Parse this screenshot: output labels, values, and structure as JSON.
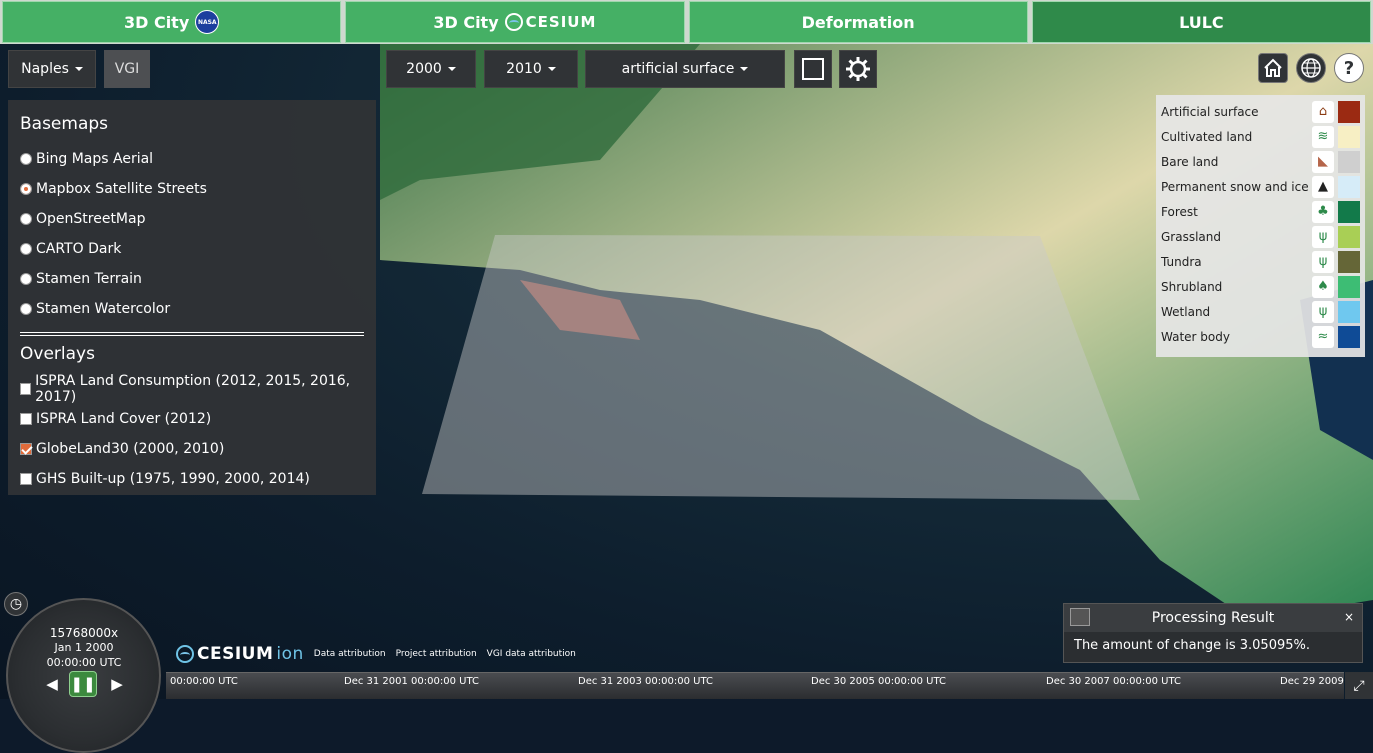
{
  "tabs": [
    {
      "label": "3D City",
      "logo": "nasa-logo",
      "logo_text": "NASA"
    },
    {
      "label": "3D City",
      "logo": "cesium-logo",
      "logo_text": "CESIUM"
    },
    {
      "label": "Deformation"
    },
    {
      "label": "LULC",
      "active": true
    }
  ],
  "toolbar": {
    "city": "Naples",
    "vgi": "VGI",
    "year_from": "2000",
    "year_to": "2010",
    "land_class": "artificial surface"
  },
  "panel": {
    "basemaps_title": "Basemaps",
    "basemaps": [
      {
        "label": "Bing Maps Aerial",
        "selected": false
      },
      {
        "label": "Mapbox Satellite Streets",
        "selected": true
      },
      {
        "label": "OpenStreetMap",
        "selected": false
      },
      {
        "label": "CARTO Dark",
        "selected": false
      },
      {
        "label": "Stamen Terrain",
        "selected": false
      },
      {
        "label": "Stamen Watercolor",
        "selected": false
      }
    ],
    "overlays_title": "Overlays",
    "overlays": [
      {
        "label": "ISPRA Land Consumption (2012, 2015, 2016, 2017)",
        "checked": false
      },
      {
        "label": "ISPRA Land Cover (2012)",
        "checked": false
      },
      {
        "label": "GlobeLand30 (2000, 2010)",
        "checked": true
      },
      {
        "label": "GHS Built-up (1975, 1990, 2000, 2014)",
        "checked": false
      }
    ]
  },
  "legend": [
    {
      "label": "Artificial surface",
      "color": "#9b2a12",
      "icon": "building-icon"
    },
    {
      "label": "Cultivated land",
      "color": "#f7efc4",
      "icon": "field-icon"
    },
    {
      "label": "Bare land",
      "color": "#cfcfcf",
      "icon": "bare-land-icon"
    },
    {
      "label": "Permanent snow and ice",
      "color": "#d6ecf8",
      "icon": "snow-mountain-icon"
    },
    {
      "label": "Forest",
      "color": "#127a4a",
      "icon": "tree-icon"
    },
    {
      "label": "Grassland",
      "color": "#a9cf55",
      "icon": "grass-icon"
    },
    {
      "label": "Tundra",
      "color": "#656637",
      "icon": "tundra-icon"
    },
    {
      "label": "Shrubland",
      "color": "#3dbd74",
      "icon": "shrub-icon"
    },
    {
      "label": "Wetland",
      "color": "#6fc8ef",
      "icon": "wetland-icon"
    },
    {
      "label": "Water body",
      "color": "#0f4b96",
      "icon": "water-icon"
    }
  ],
  "animation": {
    "speed": "15768000x",
    "date": "Jan 1 2000",
    "time": "00:00:00 UTC"
  },
  "timeline": {
    "ticks": [
      "00:00:00 UTC",
      "Dec 31 2001 00:00:00 UTC",
      "Dec 31 2003 00:00:00 UTC",
      "Dec 30 2005 00:00:00 UTC",
      "Dec 30 2007 00:00:00 UTC",
      "Dec 29 2009"
    ]
  },
  "credits": {
    "logo": "CESIUM",
    "logo_suffix": "ion",
    "links": [
      "Data attribution",
      "Project attribution",
      "VGI data attribution"
    ]
  },
  "toast": {
    "title": "Processing Result",
    "message": "The amount of change is 3.05095%.",
    "close": "×"
  }
}
